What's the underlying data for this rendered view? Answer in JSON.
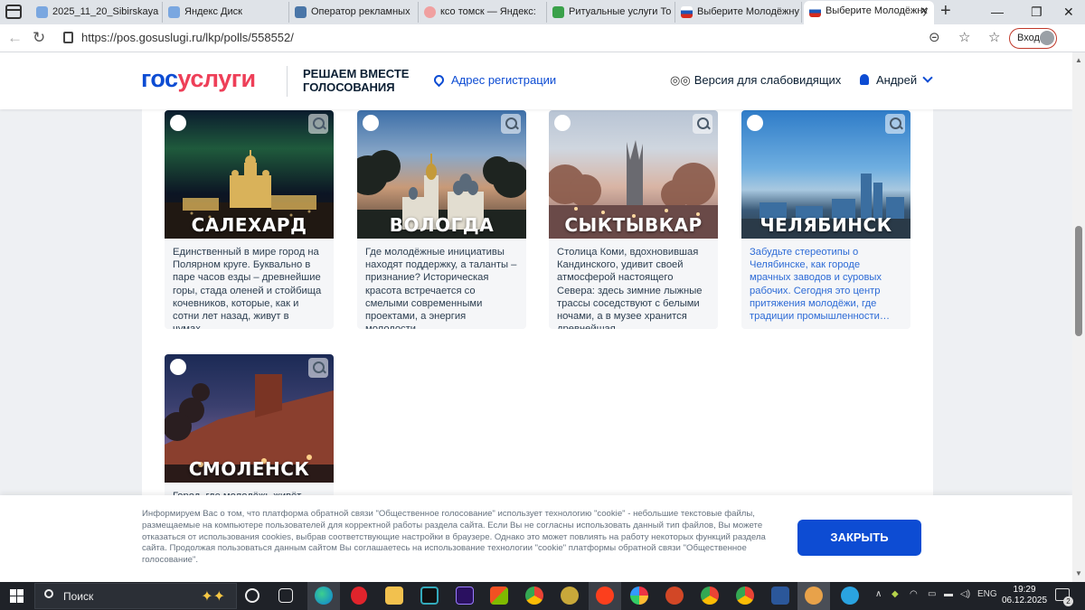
{
  "browser": {
    "tabs": [
      {
        "label": "2025_11_20_Sibirskaya",
        "favicon_color": "#7aa7e0"
      },
      {
        "label": "Яндекс Диск",
        "favicon_color": "#7aa7e0"
      },
      {
        "label": "Оператор рекламных",
        "favicon_color": "#4a76a8"
      },
      {
        "label": "ксо томск — Яндекс:",
        "favicon_color": "#f0a0a0"
      },
      {
        "label": "Ритуальные услуги То",
        "favicon_color": "#3aa14a"
      },
      {
        "label": "Выберите Молодёжну",
        "favicon_color": "#d52b1e"
      },
      {
        "label": "Выберите Молодёжну",
        "favicon_color": "#d52b1e"
      }
    ],
    "url": "https://pos.gosuslugi.ru/lkp/polls/558552/",
    "login_label": "Вход"
  },
  "header": {
    "logo_part1": "гос",
    "logo_part2": "услуги",
    "project_title": "РЕШАЕМ ВМЕСТЕ ГОЛОСОВАНИЯ",
    "region_link": "Адрес регистрации",
    "impaired_link": "Версия для слабовидящих",
    "user_name": "Андрей"
  },
  "cards": [
    {
      "city": "САЛЕХАРД",
      "desc": "Единственный в мире город на Полярном круге. Буквально в паре часов езды – древнейшие горы, стада оленей и стойбища кочевников, которые, как и сотни лет назад, живут в чумах…",
      "link": false,
      "sky": [
        "#0b1c2e",
        "#1f5a3c",
        "#0c1524"
      ],
      "ground": "#1a1612"
    },
    {
      "city": "ВОЛОГДА",
      "desc": "Где молодёжные инициативы находят поддержку, а таланты – признание? Историческая красота встречается со смелыми современными проектами, а энергия молодости…",
      "link": false,
      "sky": [
        "#3d6fa8",
        "#c89a78",
        "#3a2f2a"
      ],
      "ground": "#2b2a26"
    },
    {
      "city": "СЫКТЫВКАР",
      "desc": "Столица Коми, вдохновившая Кандинского, удивит своей атмосферой настоящего Севера: здесь зимние лыжные трассы соседствуют с белыми ночами, а в музее хранится древнейшая …",
      "link": false,
      "sky": [
        "#b8c4d4",
        "#d8b4a4",
        "#7a5a5a"
      ],
      "ground": "#5a4a48"
    },
    {
      "city": "ЧЕЛЯБИНСК",
      "desc": "Забудьте стереотипы о Челябинске, как городе мрачных заводов и суровых рабочих. Сегодня это центр притяжения молодёжи, где традиции промышленности…",
      "link": true,
      "sky": [
        "#2f7cc8",
        "#6eaee0",
        "#3a5a78"
      ],
      "ground": "#2a3a48"
    },
    {
      "city": "СМОЛЕНСК",
      "desc": "Город, где молодёжь живёт…",
      "link": false,
      "sky": [
        "#1b2a55",
        "#6a5a8a",
        "#4a2a2a"
      ],
      "ground": "#8a3a2a"
    }
  ],
  "cookie": {
    "text": "Информируем Вас о том, что платформа обратной связи \"Общественное голосование\" использует технологию \"cookie\" - небольшие текстовые файлы, размещаемые на компьютере пользователей для корректной работы раздела сайта. Если Вы не согласны использовать данный тип файлов, Вы можете отказаться от использования cookies, выбрав соответствующие настройки в браузере. Однако это может повлиять на работу некоторых функций раздела сайта. Продолжая пользоваться данным сайтом Вы соглашаетесь на использование технологии \"cookie\" платформы обратной связи \"Общественное голосование\".",
    "button": "ЗАКРЫТЬ"
  },
  "taskbar": {
    "search_label": "Поиск",
    "lang": "ENG",
    "time": "19:29",
    "date": "06.12.2025",
    "notifications": "2"
  }
}
